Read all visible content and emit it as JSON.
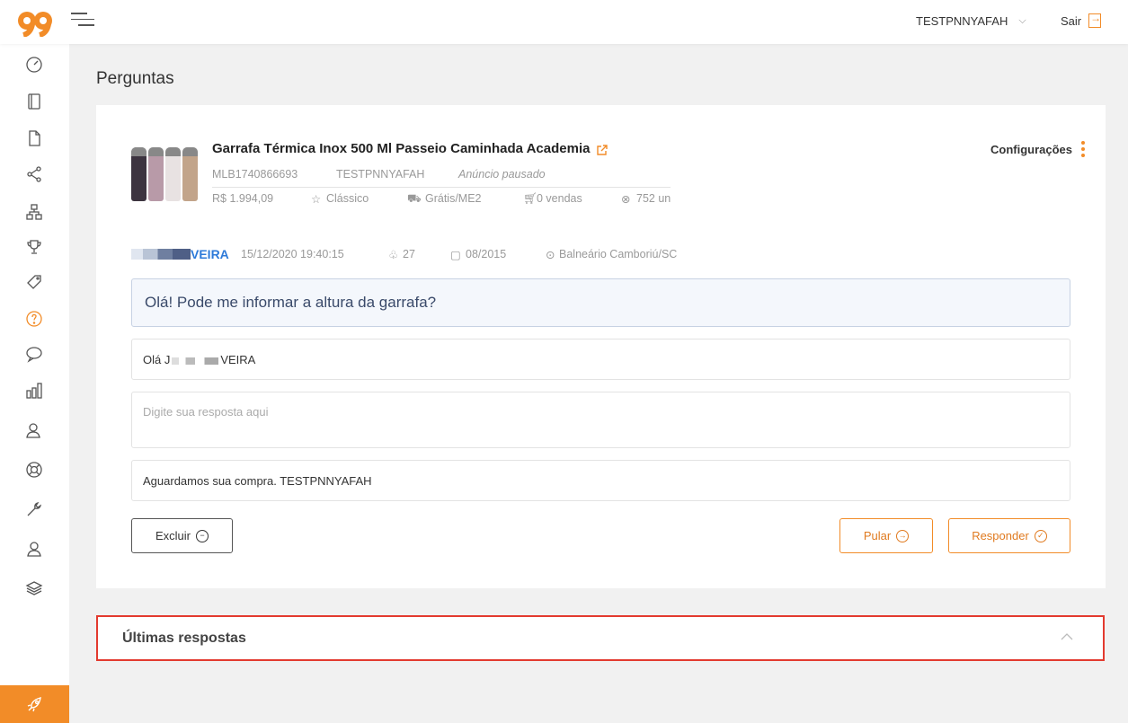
{
  "header": {
    "user_name": "TESTPNNYAFAH",
    "user_chevron": "⌵",
    "logout_label": "Sair"
  },
  "sidebar": {
    "items": [
      {
        "icon": "speedometer-icon"
      },
      {
        "icon": "notebook-icon"
      },
      {
        "icon": "document-icon"
      },
      {
        "icon": "share-icon"
      },
      {
        "icon": "hierarchy-icon"
      },
      {
        "icon": "trophy-icon"
      },
      {
        "icon": "tag-icon"
      },
      {
        "icon": "question-icon",
        "active": true
      },
      {
        "icon": "chat-bubble-icon"
      },
      {
        "icon": "bar-chart-icon"
      },
      {
        "icon": "users-icon"
      },
      {
        "icon": "lifebuoy-icon"
      },
      {
        "icon": "wrench-icon"
      },
      {
        "icon": "user-icon"
      },
      {
        "icon": "layers-icon"
      }
    ],
    "bottom_icon": "rocket-icon",
    "accent": "#f28c28"
  },
  "page": {
    "title": "Perguntas"
  },
  "product": {
    "title": "Garrafa Térmica Inox 500 Ml Passeio Caminhada Academia",
    "mlb_id": "MLB1740866693",
    "seller": "TESTPNNYAFAH",
    "status": "Anúncio pausado",
    "price": "R$ 1.994,09",
    "listing_type": "Clássico",
    "shipping": "Grátis/ME2",
    "sales": "0 vendas",
    "stock": "752 un",
    "config_label": "Configurações"
  },
  "question": {
    "asker_name": "VEIRA",
    "datetime": "15/12/2020 19:40:15",
    "asker_points": "27",
    "member_since": "08/2015",
    "location": "Balneário Camboriú/SC",
    "text": "Olá! Pode me informar a altura da garrafa?"
  },
  "response": {
    "greeting_prefix": "Olá J",
    "greeting_suffix": "VEIRA",
    "answer_placeholder": "Digite sua resposta aqui",
    "signature": "Aguardamos sua compra. TESTPNNYAFAH"
  },
  "actions": {
    "delete_label": "Excluir",
    "skip_label": "Pular",
    "respond_label": "Responder"
  },
  "last_answers": {
    "title": "Últimas respostas"
  },
  "colors": {
    "accent": "#f28c28",
    "link": "#2d7ad9",
    "highlight_border": "#e33a2f"
  }
}
